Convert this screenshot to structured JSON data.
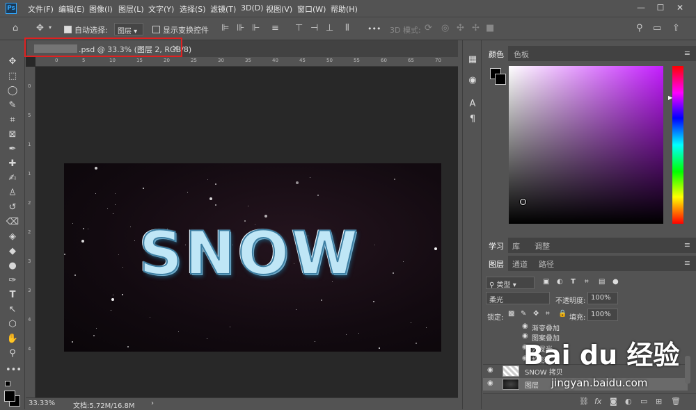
{
  "app": {
    "logo": "Ps"
  },
  "menu": [
    "文件(F)",
    "编辑(E)",
    "图像(I)",
    "图层(L)",
    "文字(Y)",
    "选择(S)",
    "滤镜(T)",
    "3D(D)",
    "视图(V)",
    "窗口(W)",
    "帮助(H)"
  ],
  "window_controls": {
    "minimize": "—",
    "restore": "☐",
    "close": "✕"
  },
  "options": {
    "auto_select_label": "自动选择:",
    "auto_select_value": "图层",
    "show_transform_label": "显示变换控件",
    "more": "•••",
    "mode_3d_label": "3D 模式:"
  },
  "document": {
    "tab_title": ".psd @ 33.3% (图层 2, RGB/8)",
    "close": "×",
    "canvas_text": "SNOW",
    "ruler_h_ticks": [
      "0",
      "5",
      "10",
      "15",
      "20",
      "25",
      "30",
      "35",
      "40",
      "45",
      "50",
      "55",
      "60",
      "65",
      "70"
    ],
    "ruler_v_ticks": [
      "0",
      "5",
      "1",
      "1",
      "2",
      "2",
      "3",
      "3",
      "4",
      "4"
    ]
  },
  "status": {
    "zoom": "33.33%",
    "doc_size": "文档:5.72M/16.8M",
    "arrow": "›"
  },
  "color_panel": {
    "tabs": [
      "颜色",
      "色板"
    ]
  },
  "learn_panel": {
    "tabs": [
      "学习",
      "库",
      "调整"
    ]
  },
  "layers_panel": {
    "tabs": [
      "图层",
      "通道",
      "路径"
    ],
    "filter_value": "类型",
    "blend_mode": "柔光",
    "opacity_label": "不透明度:",
    "opacity_value": "100%",
    "lock_label": "锁定:",
    "fill_label": "填充:",
    "fill_value": "100%",
    "effects": [
      "渐变叠加",
      "图案叠加",
      "外发光",
      "投影"
    ],
    "layers": [
      {
        "name": "SNOW 拷贝"
      },
      {
        "name": "图层"
      }
    ]
  },
  "watermark": {
    "logo": "Bai du 经验",
    "url": "jingyan.baidu.com"
  }
}
